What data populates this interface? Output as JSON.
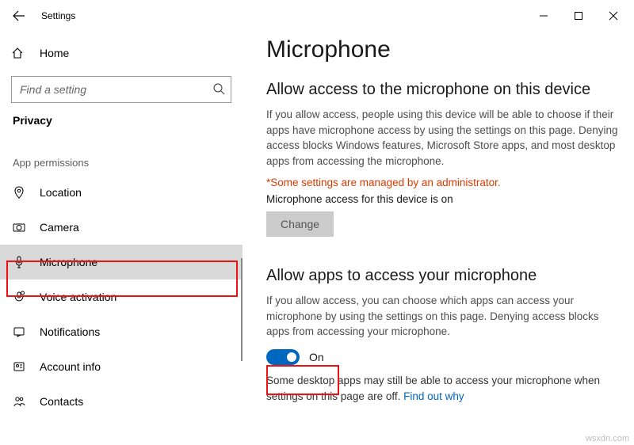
{
  "app": {
    "title": "Settings"
  },
  "sidebar": {
    "home": "Home",
    "search_placeholder": "Find a setting",
    "category": "Privacy",
    "section": "App permissions",
    "items": [
      {
        "label": "Location"
      },
      {
        "label": "Camera"
      },
      {
        "label": "Microphone"
      },
      {
        "label": "Voice activation"
      },
      {
        "label": "Notifications"
      },
      {
        "label": "Account info"
      },
      {
        "label": "Contacts"
      }
    ]
  },
  "main": {
    "title": "Microphone",
    "section1": {
      "heading": "Allow access to the microphone on this device",
      "desc": "If you allow access, people using this device will be able to choose if their apps have microphone access by using the settings on this page. Denying access blocks Windows features, Microsoft Store apps, and most desktop apps from accessing the microphone.",
      "admin_note": "*Some settings are managed by an administrator.",
      "status": "Microphone access for this device is on",
      "change_btn": "Change"
    },
    "section2": {
      "heading": "Allow apps to access your microphone",
      "desc": "If you allow access, you can choose which apps can access your microphone by using the settings on this page. Denying access blocks apps from accessing your microphone.",
      "toggle_label": "On",
      "note": "Some desktop apps may still be able to access your microphone when settings on this page are off. ",
      "link": "Find out why"
    }
  },
  "watermark": "wsxdn.com"
}
